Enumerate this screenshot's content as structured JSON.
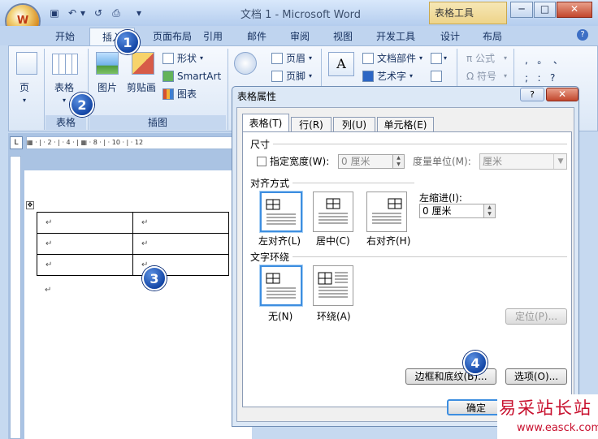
{
  "window": {
    "title": "文档 1 - Microsoft Word",
    "context_tab_header": "表格工具",
    "controls": {
      "minimize": "─",
      "maximize": "□",
      "close": "✕"
    }
  },
  "office_button": {
    "logo": "W"
  },
  "quick_access": [
    {
      "icon": "save-icon",
      "glyph": "▣"
    },
    {
      "icon": "undo-icon",
      "glyph": "↶"
    },
    {
      "icon": "undo-dropdown-icon",
      "glyph": "▾"
    },
    {
      "icon": "redo-icon",
      "glyph": "↺"
    },
    {
      "icon": "print-preview-icon",
      "glyph": "⎙"
    },
    {
      "icon": "customize-icon",
      "glyph": "▾"
    }
  ],
  "tabs": [
    "开始",
    "插入",
    "页面布局",
    "引用",
    "邮件",
    "审阅",
    "视图",
    "开发工具",
    "设计",
    "布局"
  ],
  "active_tab": "插入",
  "ribbon": {
    "pages_button": "页",
    "table_button": "表格",
    "picture_button": "图片",
    "clipart_button": "剪贴画",
    "shapes": "形状",
    "smartart": "SmartArt",
    "chart": "图表",
    "hyperlink": "链接",
    "header": "页眉",
    "footer": "页脚",
    "textbox": "文本框",
    "quickparts": "文档部件",
    "wordart": "艺术字",
    "equation": "π 公式",
    "symbol": "Ω 符号",
    "punct_row1": ",   。  、",
    "punct_row2": ";   :   ?",
    "group_table_label": "表格",
    "group_illustrations_label": "插图"
  },
  "ruler": {
    "corner": "L",
    "marks": "▦ · | · 2 · | · 4 · | ▦ · 8 · | · 10 · | · 12"
  },
  "document": {
    "rows": [
      [
        "↵",
        "↵"
      ],
      [
        "↵",
        "↵"
      ],
      [
        "↵",
        "↵"
      ]
    ],
    "after_table": "↵",
    "move_handle": "✥"
  },
  "dialog": {
    "title": "表格属性",
    "help": "?",
    "close": "✕",
    "tabs": [
      "表格(T)",
      "行(R)",
      "列(U)",
      "单元格(E)"
    ],
    "size_section": "尺寸",
    "preferred_width_label": "指定宽度(W):",
    "preferred_width_value": "0 厘米",
    "measure_in_label": "度量单位(M):",
    "measure_in_value": "厘米",
    "alignment_section": "对齐方式",
    "align_options": [
      "左对齐(L)",
      "居中(C)",
      "右对齐(H)"
    ],
    "selected_alignment": "左对齐(L)",
    "indent_label": "左缩进(I):",
    "indent_value": "0 厘米",
    "wrapping_section": "文字环绕",
    "wrap_options": [
      "无(N)",
      "环绕(A)"
    ],
    "selected_wrap": "无(N)",
    "positioning_button": "定位(P)...",
    "borders_button": "边框和底纹(B)...",
    "options_button": "选项(O)...",
    "ok_button": "确定"
  },
  "step_badges": [
    "1",
    "2",
    "3",
    "4"
  ],
  "watermark": {
    "title": "易采站长站",
    "url": "www.easck.com"
  },
  "colors": {
    "badge": "#1548a8",
    "ribbon": "#dbe7f6",
    "watermark": "#c8102e"
  }
}
